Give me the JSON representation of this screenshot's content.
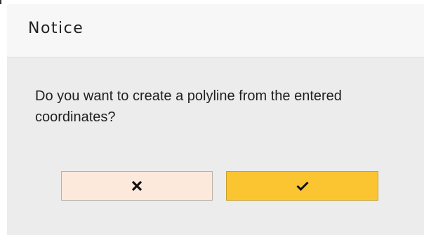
{
  "dialog": {
    "title": "Notice",
    "message": "Do you want to create a polyline from the entered coordinates?",
    "buttons": {
      "cancel": {
        "icon": "close-icon"
      },
      "confirm": {
        "icon": "check-icon"
      }
    }
  },
  "colors": {
    "header_bg": "#f7f7f7",
    "body_bg": "#ececec",
    "cancel_bg": "#fde9dc",
    "confirm_bg": "#fbc531"
  }
}
